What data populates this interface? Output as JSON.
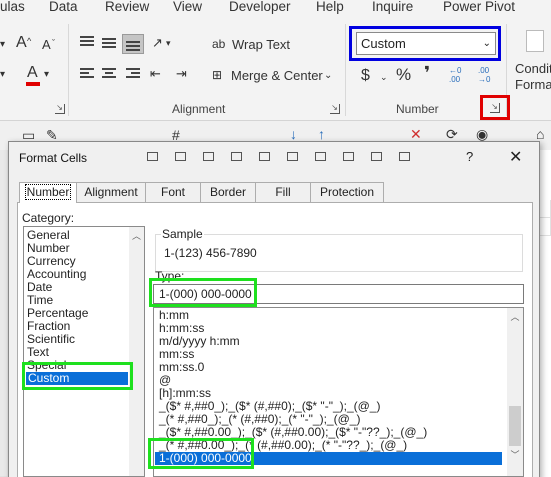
{
  "menu": [
    "ulas",
    "Data",
    "Review",
    "View",
    "Developer",
    "Help",
    "Inquire",
    "Power Pivot"
  ],
  "ribbon": {
    "wrap_text": "Wrap Text",
    "merge_center": "Merge & Center",
    "alignment_label": "Alignment",
    "number_label": "Number",
    "number_format_value": "Custom",
    "currency_symbol": "$",
    "percent_symbol": "%",
    "comma_symbol": "❜",
    "increase_decimal": "←0 .00",
    "decrease_decimal": ".00 →0",
    "conditional_line1": "Condit",
    "conditional_line2": "Format",
    "font_a_large": "A",
    "font_a_small": "A",
    "font_color_a": "A"
  },
  "dialog": {
    "title": "Format Cells",
    "help": "?",
    "close": "✕",
    "tabs": [
      "Number",
      "Alignment",
      "Font",
      "Border",
      "Fill",
      "Protection"
    ],
    "active_tab": "Number",
    "category_label": "Category:",
    "categories": [
      "General",
      "Number",
      "Currency",
      "Accounting",
      "Date",
      "Time",
      "Percentage",
      "Fraction",
      "Scientific",
      "Text",
      "Special",
      "Custom"
    ],
    "selected_category": "Custom",
    "sample_label": "Sample",
    "sample_value": "1-(123) 456-7890",
    "type_label": "Type:",
    "type_value": "1-(000) 000-0000",
    "formats": [
      "h:mm",
      "h:mm:ss",
      "m/d/yyyy h:mm",
      "mm:ss",
      "mm:ss.0",
      "@",
      "[h]:mm:ss",
      "_($* #,##0_);_($* (#,##0);_($* \"-\"_);_(@_)",
      "_(* #,##0_);_(* (#,##0);_(* \"-\"_);_(@_)",
      "_($* #,##0.00_);_($* (#,##0.00);_($* \"-\"??_);_(@_)",
      "_(* #,##0.00_);_(* (#,##0.00);_(* \"-\"??_);_(@_)",
      "1-(000) 000-0000"
    ],
    "selected_format": "1-(000) 000-0000"
  },
  "colors": {
    "highlight_blue": "#0000e0",
    "highlight_red": "#e00000",
    "highlight_green": "#1ee01e",
    "selection": "#0a6fd8"
  }
}
